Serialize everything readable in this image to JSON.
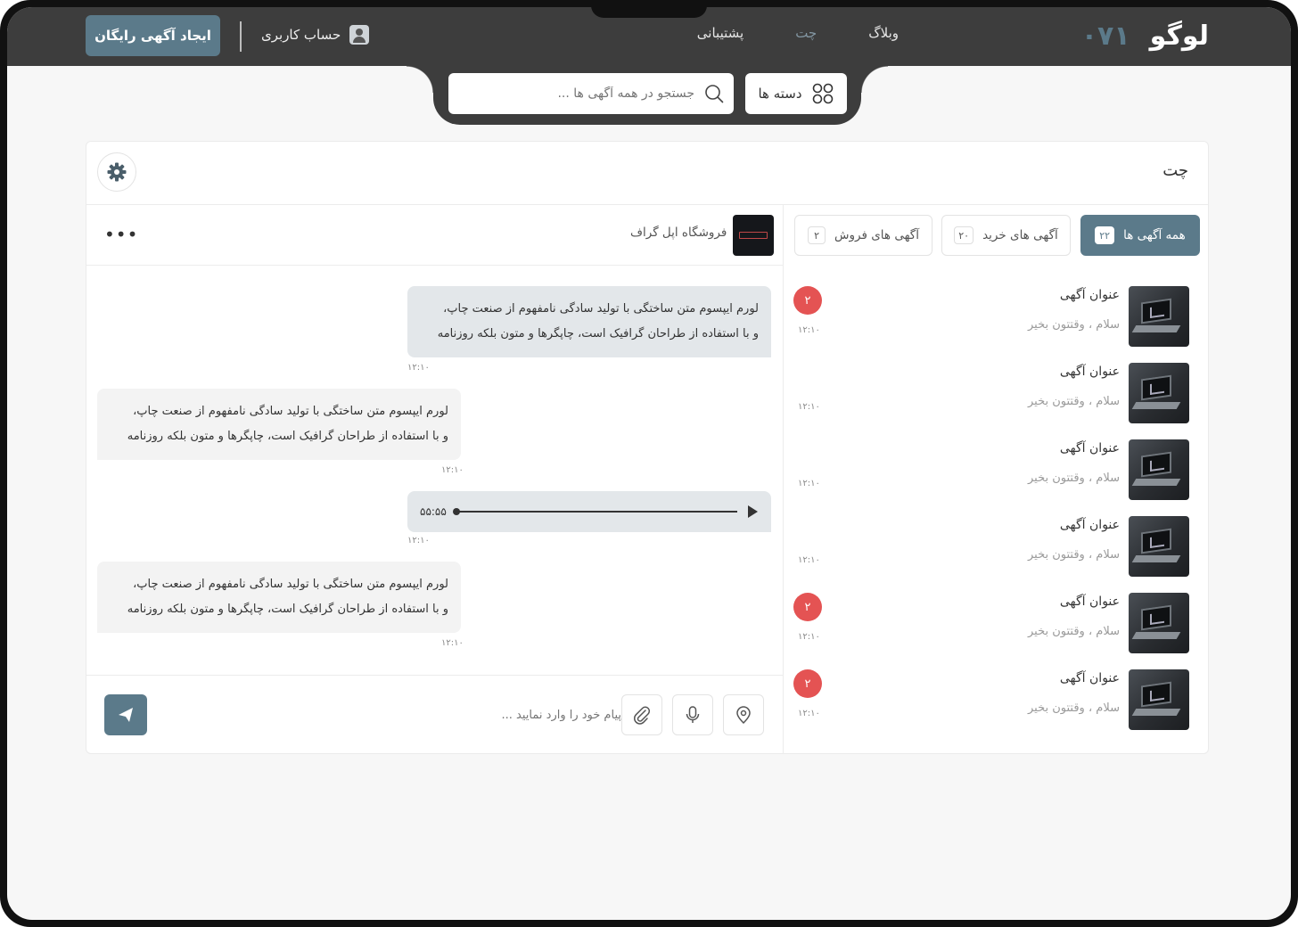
{
  "header": {
    "logo_text": "لوگو",
    "logo_number": "۰۷۱",
    "nav": [
      "وبلاگ",
      "چت",
      "پشتیبانی"
    ],
    "nav_active": "چت",
    "account_label": "حساب کاربری",
    "create_ad_label": "ایجاد آگهی رایگان"
  },
  "search": {
    "placeholder": "جستجو در همه آگهی ها ...",
    "categories_label": "دسته ها"
  },
  "panel": {
    "title": "چت"
  },
  "tabs": [
    {
      "label": "همه آگهی ها",
      "count": "۲۲",
      "active": true
    },
    {
      "label": "آگهی های خرید",
      "count": "۲۰",
      "active": false
    },
    {
      "label": "آگهی های فروش",
      "count": "۲",
      "active": false
    }
  ],
  "conversations": [
    {
      "title": "عنوان آگهی",
      "preview": "سلام ، وقتتون بخیر",
      "time": "۱۲:۱۰",
      "badge": "۲"
    },
    {
      "title": "عنوان آگهی",
      "preview": "سلام ، وقتتون بخیر",
      "time": "۱۲:۱۰",
      "badge": ""
    },
    {
      "title": "عنوان آگهی",
      "preview": "سلام ، وقتتون بخیر",
      "time": "۱۲:۱۰",
      "badge": ""
    },
    {
      "title": "عنوان آگهی",
      "preview": "سلام ، وقتتون بخیر",
      "time": "۱۲:۱۰",
      "badge": ""
    },
    {
      "title": "عنوان آگهی",
      "preview": "سلام ، وقتتون بخیر",
      "time": "۱۲:۱۰",
      "badge": "۲"
    },
    {
      "title": "عنوان آگهی",
      "preview": "سلام ، وقتتون بخیر",
      "time": "۱۲:۱۰",
      "badge": "۲"
    }
  ],
  "chat": {
    "store_name": "فروشگاه اپل گراف",
    "more_label": "•••",
    "messages": [
      {
        "side": "sent",
        "line1": "لورم ایپسوم متن ساختگی با تولید سادگی نامفهوم از صنعت چاپ،",
        "line2": "و با استفاده از طراحان گرافیک است، چاپگرها و متون بلکه روزنامه",
        "time": "۱۲:۱۰"
      },
      {
        "side": "recv",
        "line1": "لورم ایپسوم متن ساختگی با تولید سادگی نامفهوم از صنعت چاپ،",
        "line2": "و با استفاده از طراحان گرافیک است، چاپگرها و متون بلکه روزنامه",
        "time": "۱۲:۱۰"
      },
      {
        "side": "recv",
        "line1": "لورم ایپسوم متن ساختگی با تولید سادگی نامفهوم از صنعت چاپ،",
        "line2": "و با استفاده از طراحان گرافیک است، چاپگرها و متون بلکه روزنامه",
        "time": "۱۲:۱۰"
      }
    ],
    "voice": {
      "duration": "۵۵:۵۵",
      "time": "۱۲:۱۰"
    },
    "input_placeholder": "پیام خود را وارد نمایید ..."
  },
  "colors": {
    "header_bg": "#3d3d3d",
    "accent": "#5b7a8a",
    "badge": "#e45353"
  }
}
